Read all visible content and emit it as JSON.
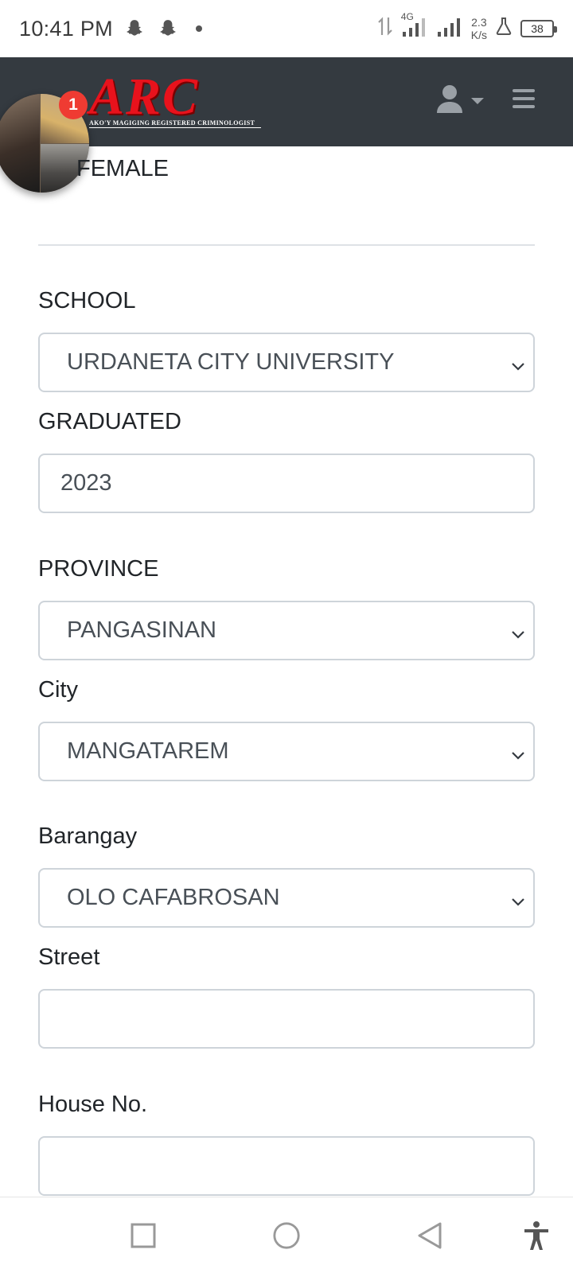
{
  "status_bar": {
    "time": "10:41 PM",
    "network_type": "4G",
    "speed_value": "2.3",
    "speed_unit": "K/s",
    "battery": "38",
    "icons": [
      "snapchat-icon",
      "snapchat-icon",
      "data-arrows-icon",
      "signal-icon",
      "signal-icon",
      "lab-icon",
      "battery-icon"
    ]
  },
  "navbar": {
    "brand": "ARC",
    "brand_tagline": "AKO'Y MAGIGING REGISTERED CRIMINOLOGIST",
    "background": "#343a40",
    "brand_color": "#e8121c",
    "icons": [
      "user-icon",
      "caret-down-icon",
      "hamburger-menu-icon"
    ]
  },
  "chat_head": {
    "badge_count": "1",
    "badge_color": "#ef3b32"
  },
  "form": {
    "gender_value": "FEMALE",
    "school": {
      "label": "SCHOOL",
      "value": "URDANETA CITY UNIVERSITY"
    },
    "graduated": {
      "label": "GRADUATED",
      "value": "2023"
    },
    "province": {
      "label": "PROVINCE",
      "value": "PANGASINAN"
    },
    "city": {
      "label": "City",
      "value": "MANGATAREM"
    },
    "barangay": {
      "label": "Barangay",
      "value": "OLO CAFABROSAN"
    },
    "street": {
      "label": "Street",
      "value": ""
    },
    "house_no": {
      "label": "House No.",
      "value": ""
    }
  },
  "system_nav": {
    "icons": [
      "recent-apps-icon",
      "home-icon",
      "back-icon",
      "accessibility-icon"
    ]
  }
}
